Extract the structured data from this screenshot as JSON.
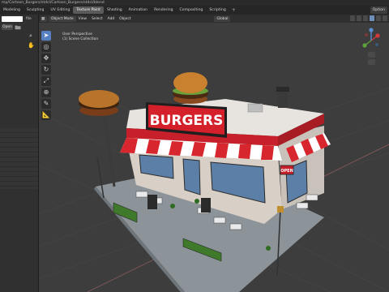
{
  "titlebar": {
    "text": "mp/Cartoon_Burgers/stdcl/Cartoon_Burgers/stdcl/blend"
  },
  "workspaces": [
    {
      "label": "Modeling",
      "active": false
    },
    {
      "label": "Sculpting",
      "active": false
    },
    {
      "label": "UV Editing",
      "active": false
    },
    {
      "label": "Texture Paint",
      "active": true
    },
    {
      "label": "Shading",
      "active": false
    },
    {
      "label": "Animation",
      "active": false
    },
    {
      "label": "Rendering",
      "active": false
    },
    {
      "label": "Compositing",
      "active": false
    },
    {
      "label": "Scripting",
      "active": false
    }
  ],
  "workspace_add": "+",
  "top_right": {
    "label": "Option"
  },
  "left_panel": {
    "field_label": "file",
    "open_button": "Open"
  },
  "viewport_header": {
    "mode": "Object Mode",
    "menus": [
      "View",
      "Select",
      "Add",
      "Object"
    ],
    "transform_orientation": "Global"
  },
  "viewport_overlay": {
    "line1": "User Perspective",
    "line2": "(1) Scene Collection"
  },
  "scene": {
    "sign_text": "BURGERS",
    "open_sign": "OPEN"
  },
  "tools": [
    "select-box",
    "cursor",
    "move",
    "rotate",
    "scale",
    "transform",
    "annotate",
    "measure"
  ],
  "colors": {
    "selected_tool": "#5680c2",
    "active_tab": "#5a5a5a",
    "awning_red": "#d8262e",
    "grid_floor": "#3d3d3d"
  }
}
